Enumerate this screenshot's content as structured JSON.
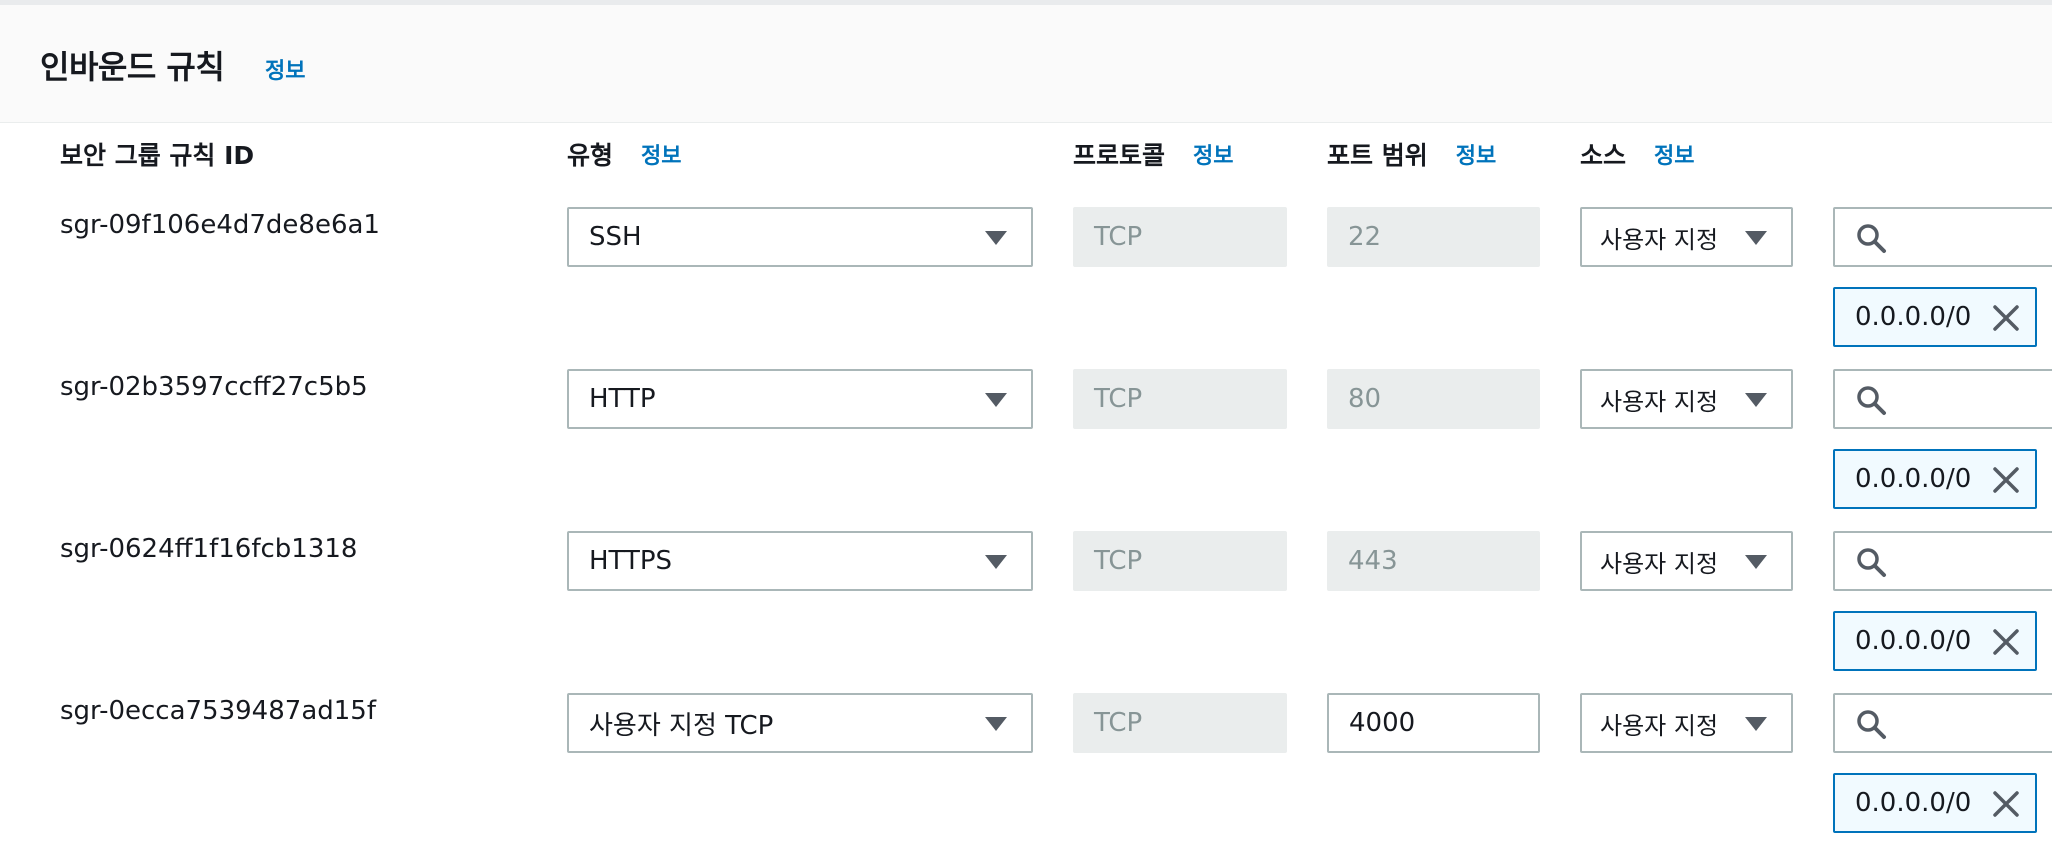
{
  "header": {
    "title": "인바운드 규칙",
    "info_label": "정보"
  },
  "columns": {
    "rule_id": "보안 그룹 규칙 ID",
    "type": "유형",
    "protocol": "프로토콜",
    "port_range": "포트 범위",
    "source": "소스",
    "info_label": "정보"
  },
  "rules": [
    {
      "id": "sgr-09f106e4d7de8e6a1",
      "type": "SSH",
      "protocol": "TCP",
      "port": "22",
      "port_editable": false,
      "source_type": "사용자 지정",
      "cidr": "0.0.0.0/0"
    },
    {
      "id": "sgr-02b3597ccff27c5b5",
      "type": "HTTP",
      "protocol": "TCP",
      "port": "80",
      "port_editable": false,
      "source_type": "사용자 지정",
      "cidr": "0.0.0.0/0"
    },
    {
      "id": "sgr-0624ff1f16fcb1318",
      "type": "HTTPS",
      "protocol": "TCP",
      "port": "443",
      "port_editable": false,
      "source_type": "사용자 지정",
      "cidr": "0.0.0.0/0"
    },
    {
      "id": "sgr-0ecca7539487ad15f",
      "type": "사용자 지정 TCP",
      "protocol": "TCP",
      "port": "4000",
      "port_editable": true,
      "source_type": "사용자 지정",
      "cidr": "0.0.0.0/0"
    }
  ],
  "icons": {
    "caret": "chevron-down-icon",
    "search": "search-icon",
    "remove": "close-icon"
  },
  "colors": {
    "link": "#0073bb",
    "token_border": "#0073bb",
    "token_background": "#f1faff",
    "disabled_background": "#eaeded"
  }
}
